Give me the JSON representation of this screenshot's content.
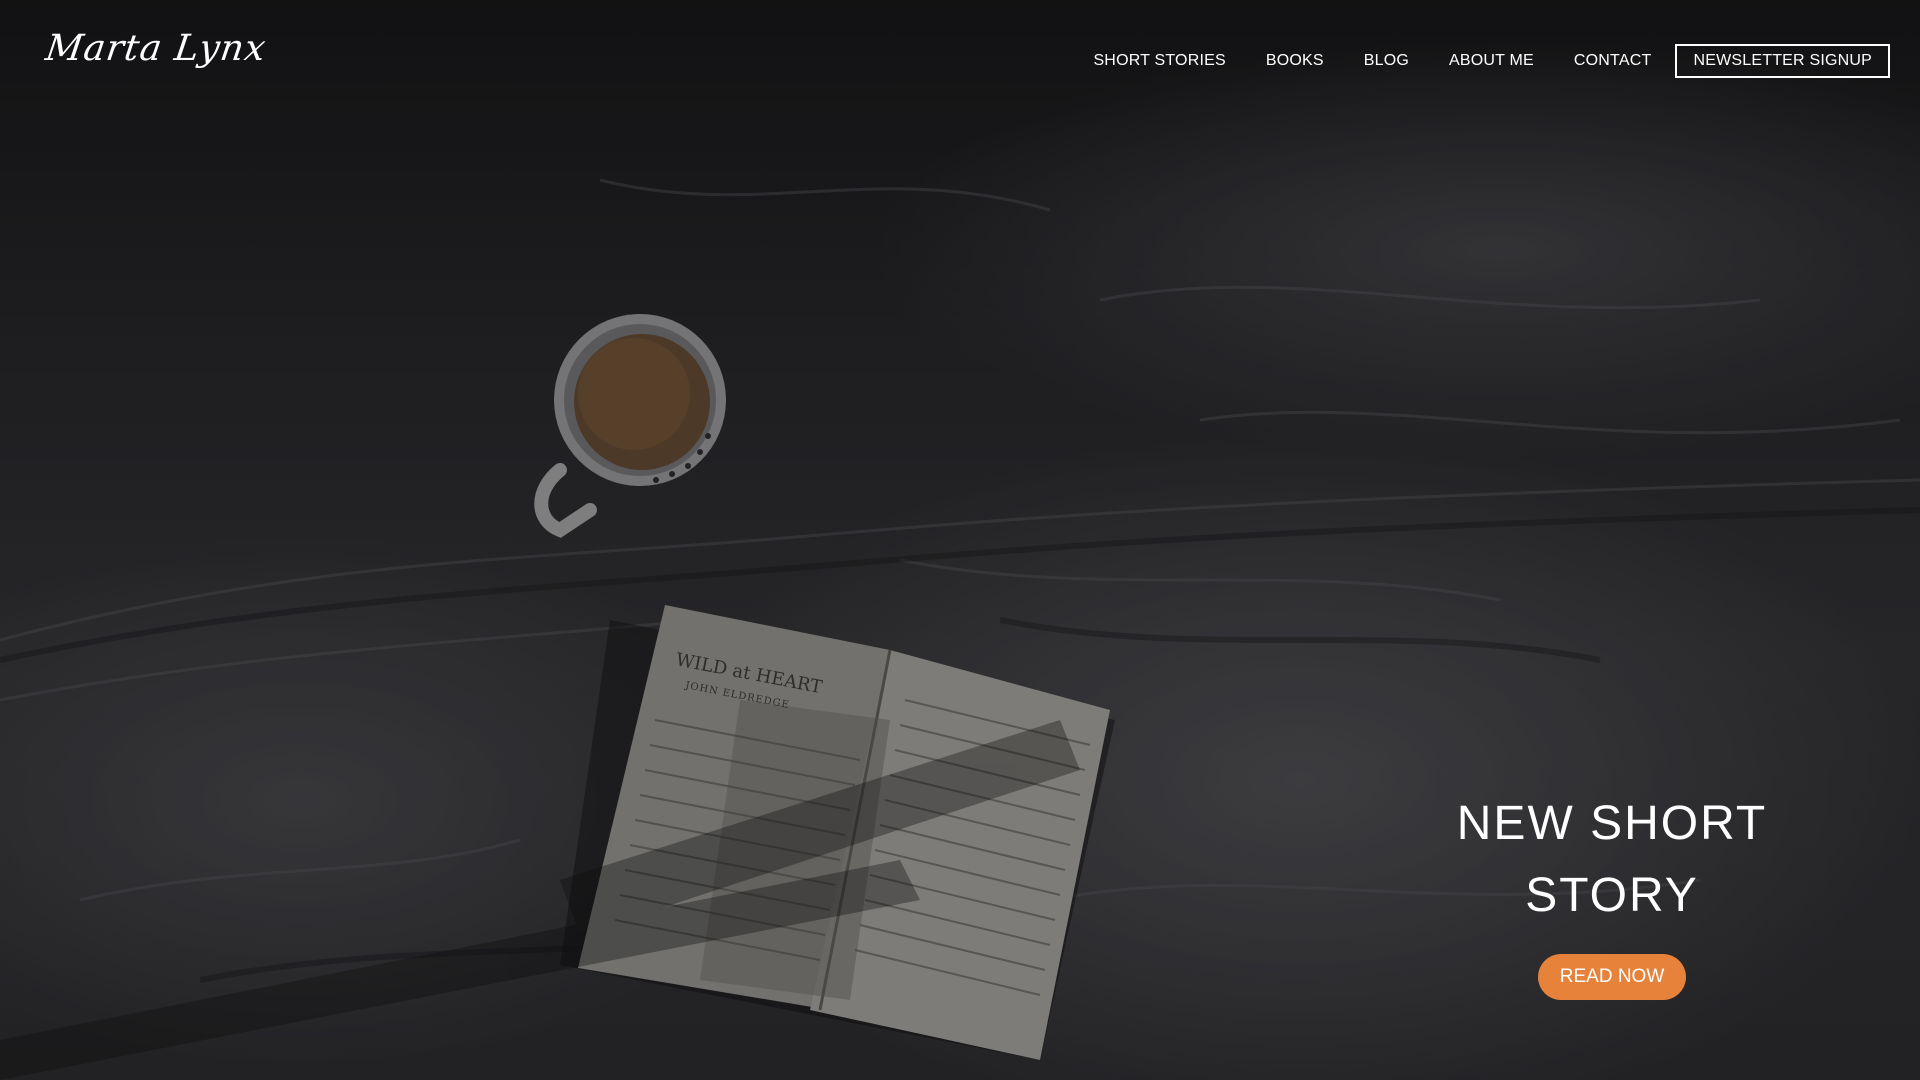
{
  "brand": {
    "logo_text": "Marta Lynx"
  },
  "nav": {
    "items": [
      {
        "label": "SHORT STORIES"
      },
      {
        "label": "BOOKS"
      },
      {
        "label": "BLOG"
      },
      {
        "label": "ABOUT ME"
      },
      {
        "label": "CONTACT"
      }
    ],
    "newsletter_label": "NEWSLETTER SIGNUP"
  },
  "hero": {
    "title_line1": "NEW SHORT",
    "title_line2": "STORY",
    "button_label": "READ NOW",
    "background_image": "coffee-mug-and-open-book-on-rumpled-bed-sheets",
    "book_title_text": "WILD at HEART",
    "book_author_text": "JOHN ELDREDGE"
  },
  "colors": {
    "accent": "#e6823a",
    "text": "#ffffff",
    "background": "#2a2a2d"
  }
}
